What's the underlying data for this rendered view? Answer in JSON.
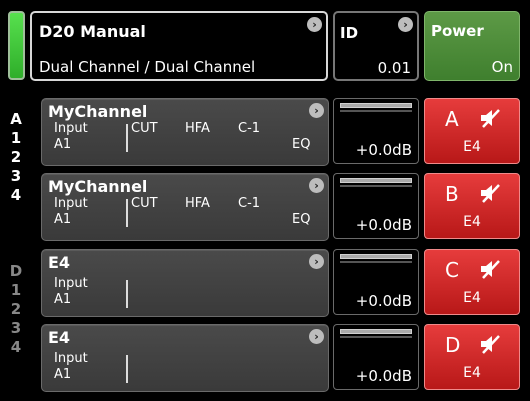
{
  "header": {
    "device_title": "D20 Manual",
    "device_mode": "Dual Channel / Dual Channel",
    "id_label": "ID",
    "id_value": "0.01",
    "power_label": "Power",
    "power_value": "On"
  },
  "colors": {
    "status_green": "#3fd43a",
    "power_green": "#4f8c3a",
    "mute_red": "#d42a2a"
  },
  "sidebar": {
    "left_items": [
      "A",
      "1",
      "2",
      "3",
      "4",
      "D",
      "1",
      "2",
      "3",
      "4"
    ]
  },
  "channels": [
    {
      "name": "MyChannel",
      "input_label": "Input",
      "input_value": "A1",
      "cut": "CUT",
      "hfa": "HFA",
      "c": "C-1",
      "eq": "EQ",
      "level": "+0.0dB",
      "mute_letter": "A",
      "mute_sub": "E4"
    },
    {
      "name": "MyChannel",
      "input_label": "Input",
      "input_value": "A1",
      "cut": "CUT",
      "hfa": "HFA",
      "c": "C-1",
      "eq": "EQ",
      "level": "+0.0dB",
      "mute_letter": "B",
      "mute_sub": "E4"
    },
    {
      "name": "E4",
      "input_label": "Input",
      "input_value": "A1",
      "level": "+0.0dB",
      "mute_letter": "C",
      "mute_sub": "E4"
    },
    {
      "name": "E4",
      "input_label": "Input",
      "input_value": "A1",
      "level": "+0.0dB",
      "mute_letter": "D",
      "mute_sub": "E4"
    }
  ],
  "icons": {
    "chevron": "chevron-right-icon",
    "speaker_mute": "speaker-mute-icon"
  }
}
